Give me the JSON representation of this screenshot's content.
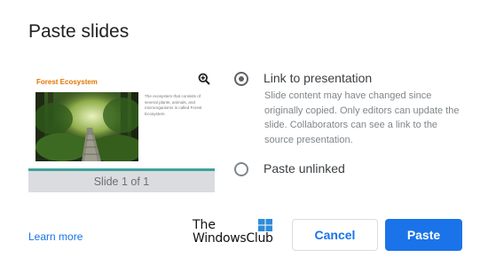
{
  "dialog": {
    "title": "Paste slides"
  },
  "preview": {
    "slide_title": "Forest Ecosystem",
    "slide_body": "The ecosystem that consists of several plants, animals, and microorganisms is called Forest Ecosystem.",
    "counter": "Slide 1 of 1",
    "zoom_icon": "zoom-in-icon",
    "accent_color": "#3fa39b",
    "title_color": "#e37400"
  },
  "options": {
    "link": {
      "label": "Link to presentation",
      "selected": true,
      "description": "Slide content may have changed since originally copied. Only editors can update the slide. Collaborators can see a link to the source presentation."
    },
    "unlinked": {
      "label": "Paste unlinked",
      "selected": false
    }
  },
  "footer": {
    "learn_more": "Learn more",
    "cancel": "Cancel",
    "paste": "Paste",
    "primary_color": "#1a73e8"
  },
  "watermark": {
    "line1": "The",
    "line2": "WindowsClub"
  }
}
